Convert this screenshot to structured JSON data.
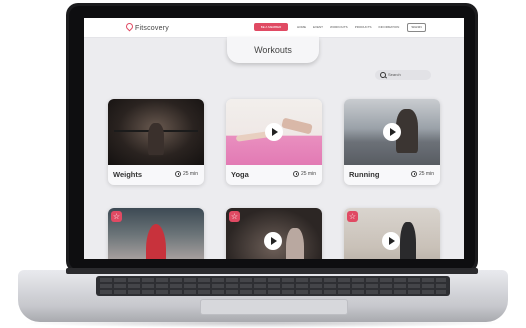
{
  "app": {
    "logo_text": "Fitscovery",
    "nav": {
      "cta_label": "BE A MEMBER",
      "menu_items": [
        "HOME",
        "EVENT",
        "WORKOUTS",
        "PRODUCTS",
        "INFORMATION"
      ],
      "button_label": "SIGNIN"
    }
  },
  "page": {
    "title": "Workouts",
    "search_placeholder": "Search"
  },
  "cards": [
    {
      "name": "Weights",
      "duration": "25 min"
    },
    {
      "name": "Yoga",
      "duration": "25 min"
    },
    {
      "name": "Running",
      "duration": "25 min"
    }
  ],
  "colors": {
    "accent": "#e04a63",
    "background": "#ececef",
    "card": "#f8f8fa"
  },
  "icons": [
    "location-pin-icon",
    "search-icon",
    "play-icon",
    "clock-icon",
    "star-icon"
  ]
}
